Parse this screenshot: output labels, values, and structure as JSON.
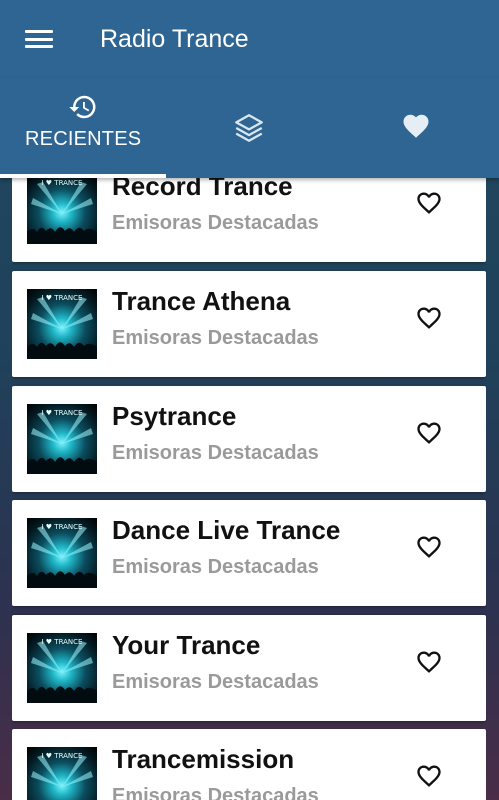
{
  "app_bar": {
    "title": "Radio Trance",
    "menu_icon": "hamburger-menu-icon"
  },
  "tabs": [
    {
      "label": "RECIENTES",
      "icon": "history-icon",
      "selected": true
    },
    {
      "label": "",
      "icon": "layers-icon",
      "selected": false
    },
    {
      "label": "",
      "icon": "heart-icon",
      "selected": false
    }
  ],
  "stations": [
    {
      "name": "Record Trance",
      "category": "Emisoras Destacadas",
      "thumb_text": "I ♥ TRANCE"
    },
    {
      "name": "Trance Athena",
      "category": "Emisoras Destacadas",
      "thumb_text": "I ♥ TRANCE"
    },
    {
      "name": "Psytrance",
      "category": "Emisoras Destacadas",
      "thumb_text": "I ♥ TRANCE"
    },
    {
      "name": "Dance Live Trance",
      "category": "Emisoras Destacadas",
      "thumb_text": "I ♥ TRANCE"
    },
    {
      "name": "Your Trance",
      "category": "Emisoras Destacadas",
      "thumb_text": "I ♥ TRANCE"
    },
    {
      "name": "Trancemission",
      "category": "Emisoras Destacadas",
      "thumb_text": "I ♥ TRANCE"
    }
  ],
  "colors": {
    "app_bar": "#2f6592",
    "tab_indicator": "#ffffff",
    "station_name": "#111111",
    "station_category": "#9a9a9a"
  }
}
